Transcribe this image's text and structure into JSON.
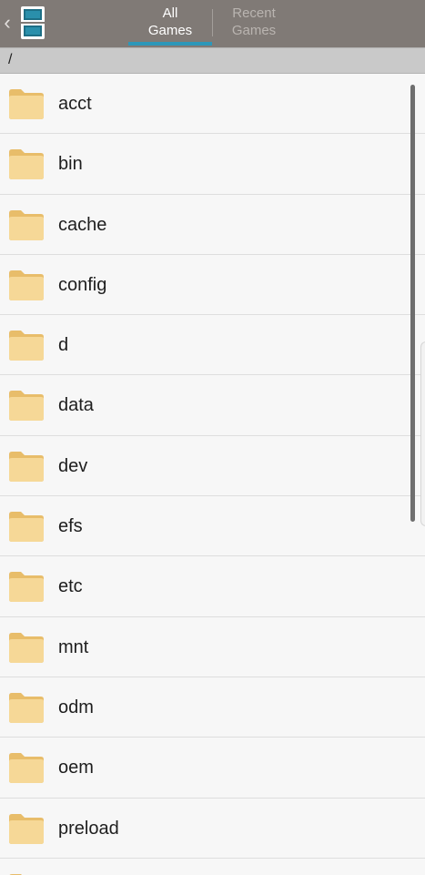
{
  "header": {
    "back_glyph": "‹",
    "tabs": [
      {
        "line1": "All",
        "line2": "Games",
        "active": true
      },
      {
        "line1": "Recent",
        "line2": "Games",
        "active": false
      }
    ]
  },
  "path": "/",
  "colors": {
    "topbar": "#807a76",
    "tab_indicator": "#2d97b9",
    "folder": "#f3d28f"
  },
  "folders": [
    {
      "name": "acct",
      "icon": "folder-icon"
    },
    {
      "name": "bin",
      "icon": "folder-icon"
    },
    {
      "name": "cache",
      "icon": "folder-icon"
    },
    {
      "name": "config",
      "icon": "folder-icon"
    },
    {
      "name": "d",
      "icon": "folder-icon"
    },
    {
      "name": "data",
      "icon": "folder-icon"
    },
    {
      "name": "dev",
      "icon": "folder-icon"
    },
    {
      "name": "efs",
      "icon": "folder-icon"
    },
    {
      "name": "etc",
      "icon": "folder-icon"
    },
    {
      "name": "mnt",
      "icon": "folder-icon"
    },
    {
      "name": "odm",
      "icon": "folder-icon"
    },
    {
      "name": "oem",
      "icon": "folder-icon"
    },
    {
      "name": "preload",
      "icon": "folder-icon"
    },
    {
      "name": "",
      "icon": "folder-icon"
    }
  ]
}
